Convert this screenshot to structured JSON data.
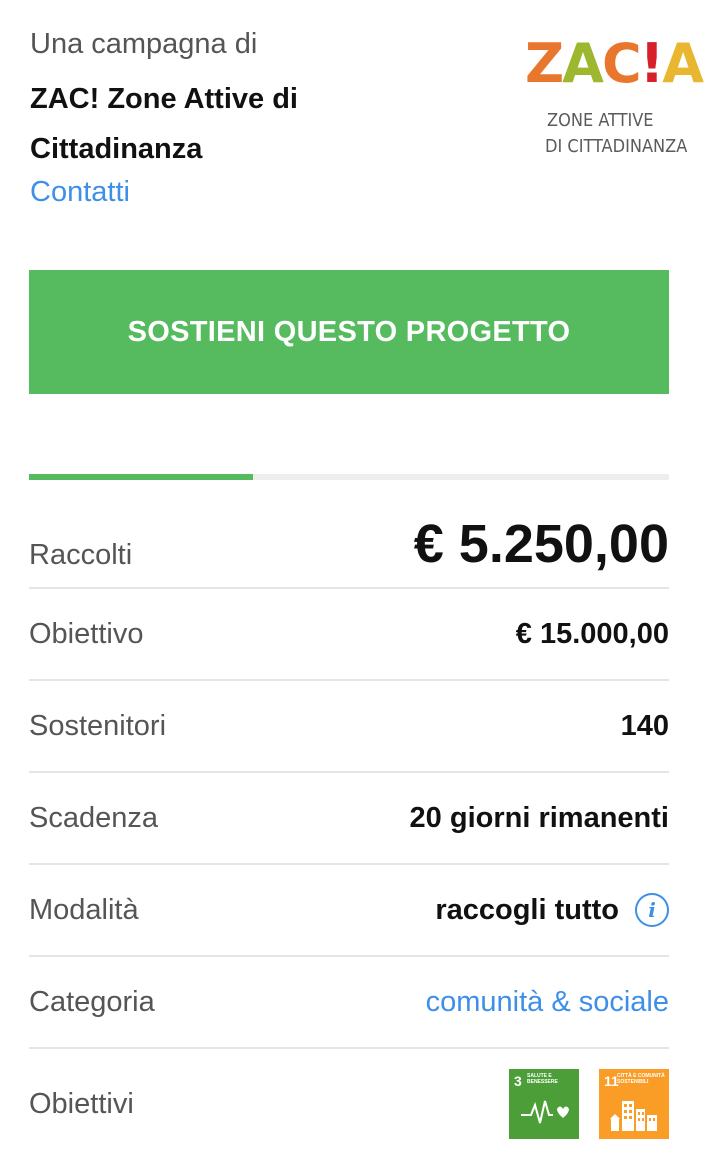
{
  "campaign": {
    "intro": "Una campagna di",
    "organizer": "ZAC! Zone Attive di Cittadinanza",
    "contacts_link": "Contatti"
  },
  "logo": {
    "letters": [
      "Z",
      "A",
      "C",
      "!",
      "A"
    ],
    "line1": "ZONE ATTIVE",
    "line2": "DI CITTADINANZA",
    "colors": {
      "orange": "#e8762d",
      "green": "#9db72f",
      "red": "#d7202b",
      "yellow": "#e9b72f"
    }
  },
  "cta": {
    "label": "SOSTIENI QUESTO PROGETTO",
    "color": "#56bb5f"
  },
  "progress": {
    "fraction": 0.35,
    "color": "#56bb5f"
  },
  "stats": {
    "raised": {
      "label": "Raccolti",
      "value": "€ 5.250,00"
    },
    "goal": {
      "label": "Obiettivo",
      "value": "€ 15.000,00"
    },
    "backers": {
      "label": "Sostenitori",
      "value": "140"
    },
    "deadline": {
      "label": "Scadenza",
      "value": "20 giorni rimanenti"
    },
    "mode": {
      "label": "Modalità",
      "value": "raccogli tutto",
      "icon": "info-icon"
    },
    "category": {
      "label": "Categoria",
      "value": "comunità & sociale"
    },
    "objectives": {
      "label": "Obiettivi",
      "goals": [
        {
          "number": "3",
          "title": "SALUTE E BENESSERE",
          "color": "#4c9f38",
          "icon": "heartbeat-icon"
        },
        {
          "number": "11",
          "title": "CITTÀ E COMUNITÀ SOSTENIBILI",
          "color": "#f99d26",
          "icon": "city-buildings-icon"
        }
      ]
    }
  },
  "link_color": "#3d8fe8"
}
